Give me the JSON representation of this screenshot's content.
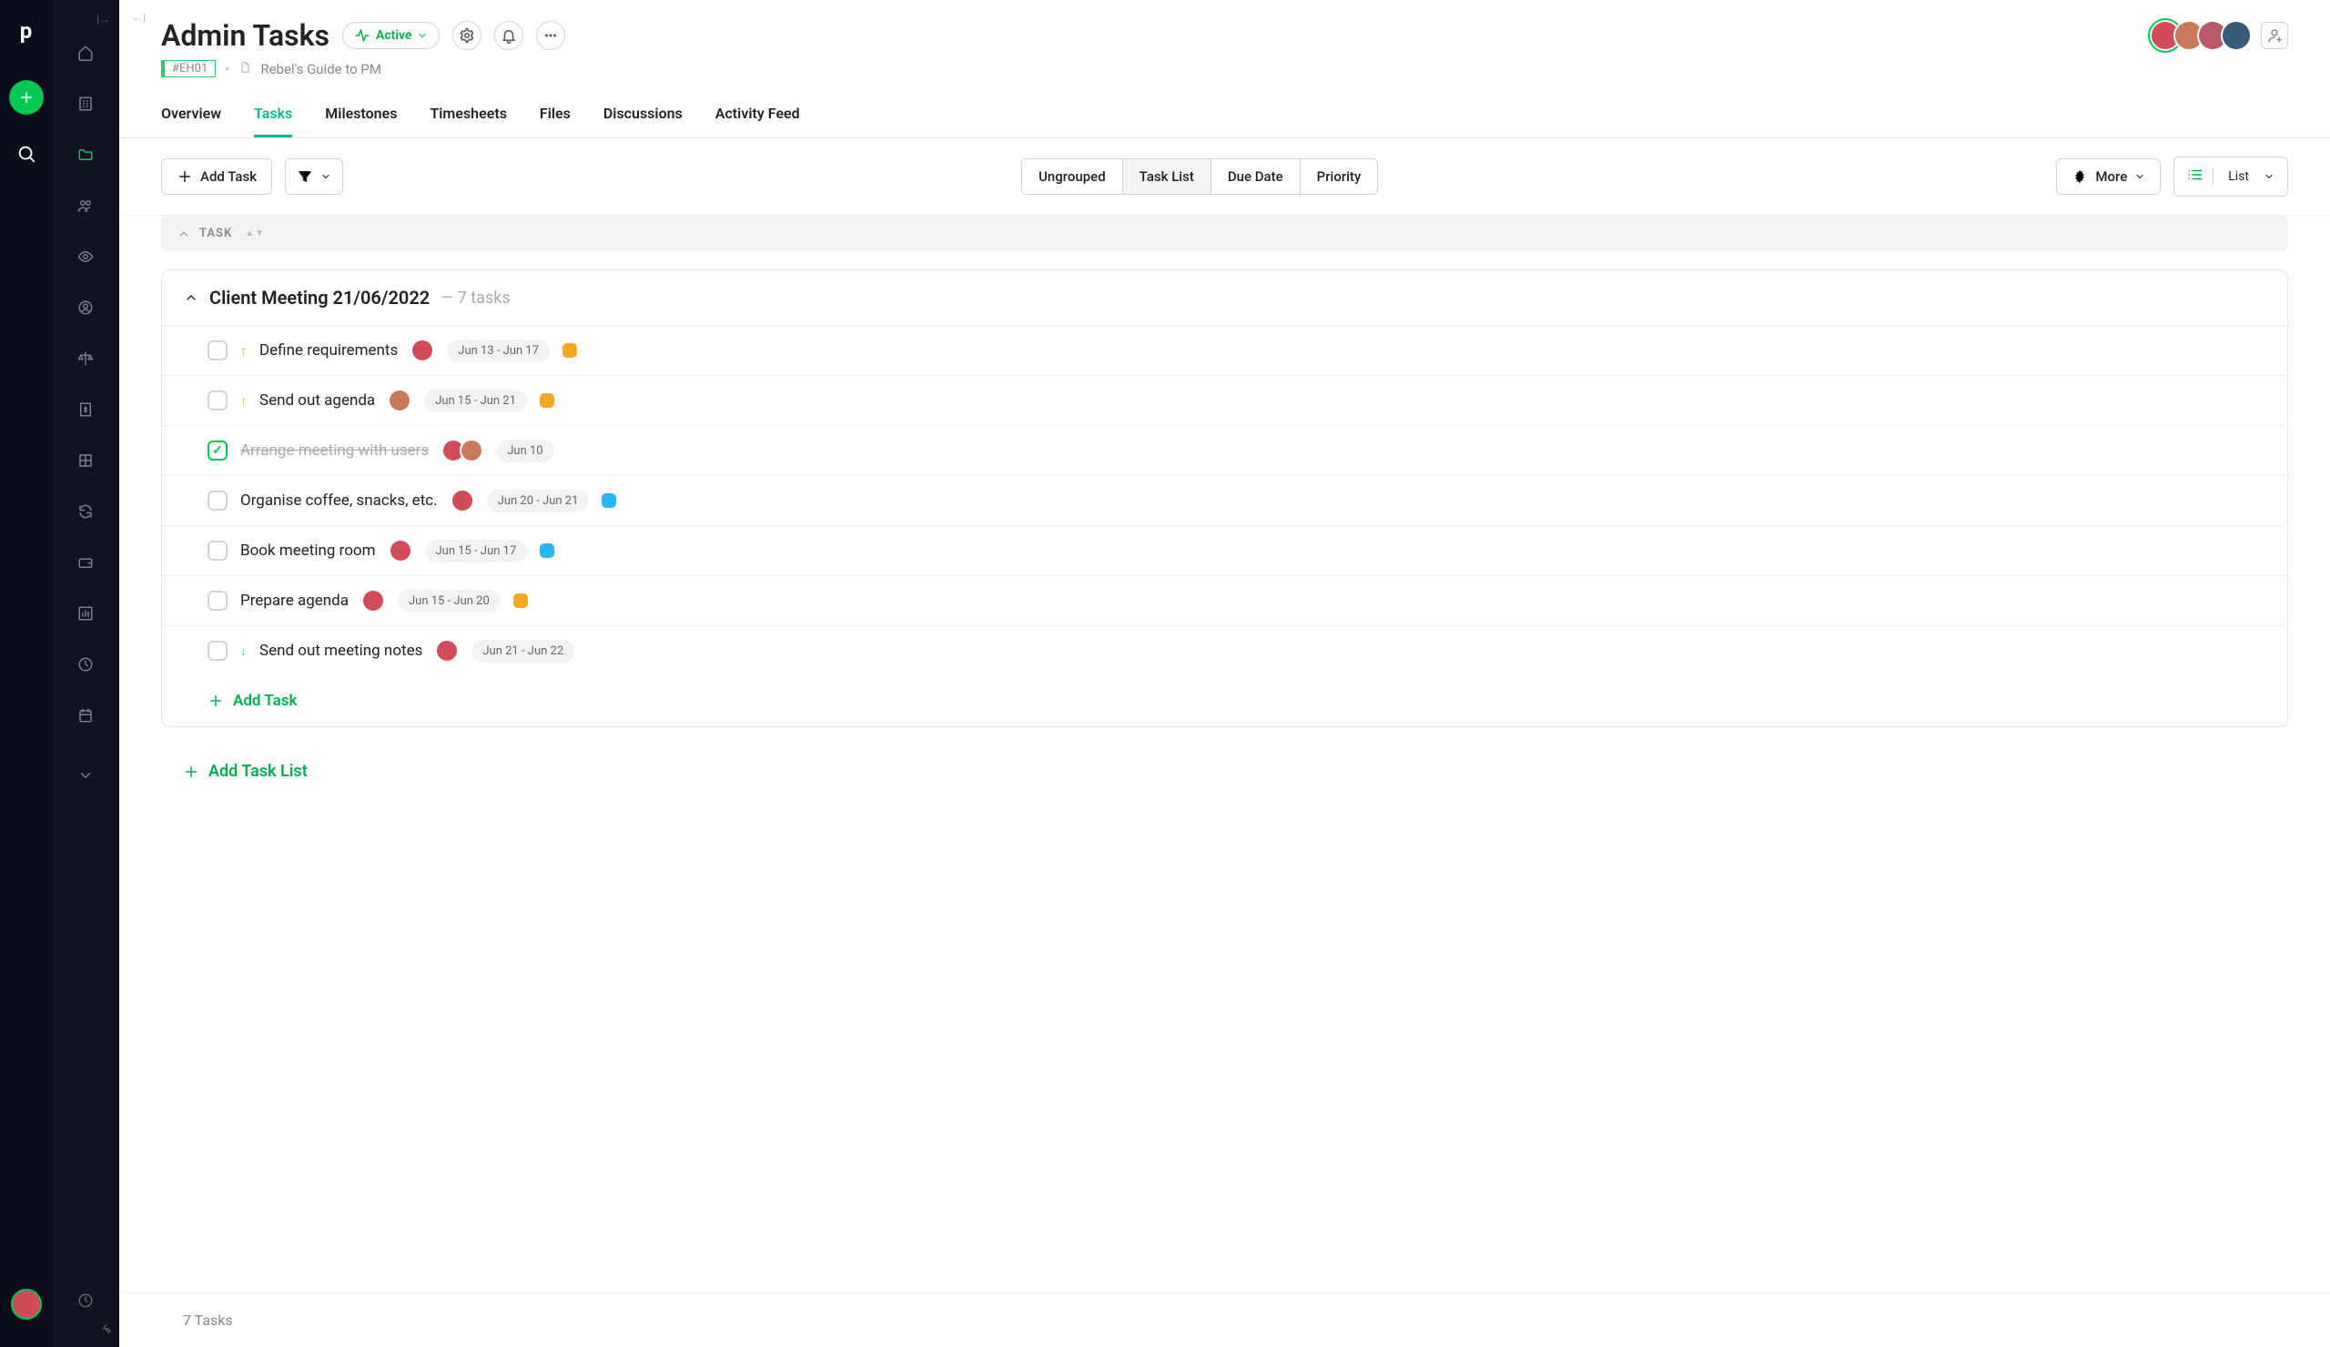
{
  "header": {
    "title": "Admin Tasks",
    "status_label": "Active",
    "tag": "#EH01",
    "breadcrumb": "Rebel's Guide to PM",
    "avatars": [
      "c1",
      "c2",
      "c3",
      "c4"
    ]
  },
  "tabs": [
    {
      "label": "Overview",
      "active": false
    },
    {
      "label": "Tasks",
      "active": true
    },
    {
      "label": "Milestones",
      "active": false
    },
    {
      "label": "Timesheets",
      "active": false
    },
    {
      "label": "Files",
      "active": false
    },
    {
      "label": "Discussions",
      "active": false
    },
    {
      "label": "Activity Feed",
      "active": false
    }
  ],
  "toolbar": {
    "add_task": "Add Task",
    "groupings": [
      {
        "label": "Ungrouped",
        "active": false
      },
      {
        "label": "Task List",
        "active": true
      },
      {
        "label": "Due Date",
        "active": false
      },
      {
        "label": "Priority",
        "active": false
      }
    ],
    "more": "More",
    "view": "List"
  },
  "group_header": "TASK",
  "tasklist": {
    "name": "Client Meeting 21/06/2022",
    "count_label": "— 7 tasks",
    "tasks": [
      {
        "name": "Define requirements",
        "done": false,
        "priority": "up",
        "avatars": [
          "c1"
        ],
        "dates": "Jun 13 - Jun 17",
        "dot": "orange"
      },
      {
        "name": "Send out agenda",
        "done": false,
        "priority": "up",
        "avatars": [
          "c2"
        ],
        "dates": "Jun 15 - Jun 21",
        "dot": "orange"
      },
      {
        "name": "Arrange meeting with users",
        "done": true,
        "priority": null,
        "avatars": [
          "c1",
          "c2"
        ],
        "dates": "Jun 10",
        "dot": null
      },
      {
        "name": "Organise coffee, snacks, etc.",
        "done": false,
        "priority": null,
        "avatars": [
          "c1"
        ],
        "dates": "Jun 20 - Jun 21",
        "dot": "blue"
      },
      {
        "name": "Book meeting room",
        "done": false,
        "priority": null,
        "avatars": [
          "c1"
        ],
        "dates": "Jun 15 - Jun 17",
        "dot": "blue"
      },
      {
        "name": "Prepare agenda",
        "done": false,
        "priority": null,
        "avatars": [
          "c1"
        ],
        "dates": "Jun 15 - Jun 20",
        "dot": "orange"
      },
      {
        "name": "Send out meeting notes",
        "done": false,
        "priority": "down",
        "avatars": [
          "c1"
        ],
        "dates": "Jun 21 - Jun 22",
        "dot": null
      }
    ],
    "add_task_label": "Add Task"
  },
  "add_tasklist_label": "Add Task List",
  "footer": "7 Tasks"
}
